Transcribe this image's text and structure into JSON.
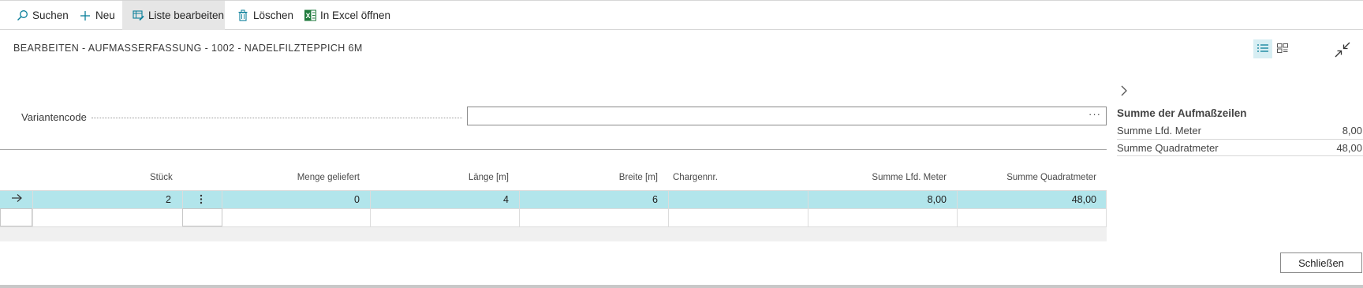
{
  "toolbar": {
    "search": "Suchen",
    "new": "Neu",
    "edit_list": "Liste bearbeiten",
    "delete": "Löschen",
    "open_excel": "In Excel öffnen"
  },
  "page": {
    "title": "BEARBEITEN - AUFMASSERFASSUNG - 1002 - NADELFILZTEPPICH 6M"
  },
  "form": {
    "variant_label": "Variantencode",
    "variant_value": "",
    "ellipsis": "···"
  },
  "grid": {
    "columns": {
      "stueck": "Stück",
      "menge": "Menge geliefert",
      "laenge": "Länge [m]",
      "breite": "Breite [m]",
      "charge": "Chargennr.",
      "summe_lfd": "Summe Lfd. Meter",
      "summe_qm": "Summe Quadratmeter"
    },
    "rows": [
      {
        "stueck": "2",
        "menge": "0",
        "laenge": "4",
        "breite": "6",
        "charge": "",
        "summe_lfd": "8,00",
        "summe_qm": "48,00"
      }
    ]
  },
  "factbox": {
    "title": "Summe der Aufmaßzeilen",
    "lfd_label": "Summe Lfd. Meter",
    "lfd_value": "8,00",
    "qm_label": "Summe Quadratmeter",
    "qm_value": "48,00"
  },
  "footer": {
    "close": "Schließen"
  },
  "colors": {
    "selected_row": "#b2e5eb",
    "accent": "#0a7f9a",
    "excel_green": "#1f7a3c"
  },
  "icons": [
    "search-icon",
    "plus-icon",
    "edit-list-icon",
    "trash-icon",
    "excel-icon",
    "list-view-icon",
    "tile-view-icon",
    "collapse-icon",
    "chevron-right-icon",
    "row-arrow-icon",
    "row-menu-icon"
  ]
}
